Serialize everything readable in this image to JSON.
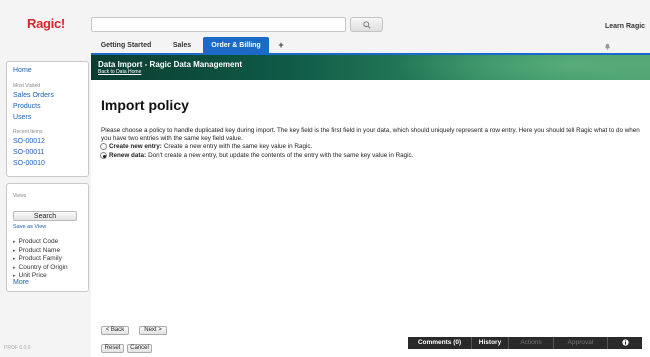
{
  "app": {
    "logo": "Ragic!",
    "version": "PROF 6.0.0"
  },
  "header": {
    "search_placeholder": "",
    "learn_label": "Learn Ragic",
    "tabs": [
      "Getting Started",
      "Sales",
      "Order & Billing",
      "+"
    ],
    "active_tab": "Order & Billing"
  },
  "sidebar": {
    "home": "Home",
    "most_visited_label": "Most Visited",
    "most_visited": [
      "Sales Orders",
      "Products",
      "Users"
    ],
    "recent_label": "Recent Items",
    "recent": [
      "SO-00012",
      "SO-00011",
      "SO-00010"
    ],
    "views_label": "Views",
    "search_button": "Search",
    "save_as_view": "Save as View",
    "fields": [
      "Product Code",
      "Product Name",
      "Product Family",
      "Country of Origin",
      "Unit Price"
    ],
    "more": "More"
  },
  "banner": {
    "title": "Data Import - Ragic Data Management",
    "back": "Back to Data Home"
  },
  "content": {
    "heading": "Import policy",
    "paragraph": "Please choose a policy to handle duplicated key during import. The key field is the first field in your data, which should uniquely represent a row entry. Here you should tell Ragic what to do when you have two entries with the same key field value.",
    "options": [
      {
        "title": "Create new entry:",
        "text": "Create a new entry with the same key value in Ragic.",
        "selected": false
      },
      {
        "title": "Renew data:",
        "text": "Don't create a new entry, but update the contents of the entry with the same key value in Ragic.",
        "selected": true
      }
    ],
    "back_button": "< Back",
    "next_button": "Next >",
    "reset_button": "Reset",
    "cancel_button": "Cancel"
  },
  "bottom_bar": {
    "comments": "Comments (0)",
    "history": "History",
    "actions": "Actions",
    "approval": "Approval",
    "info_icon": "info-icon"
  },
  "colors": {
    "brand_red": "#d8262c",
    "tab_blue": "#1b6ac7",
    "link_blue": "#1d5fb3",
    "banner_green": "#0f5a46"
  }
}
